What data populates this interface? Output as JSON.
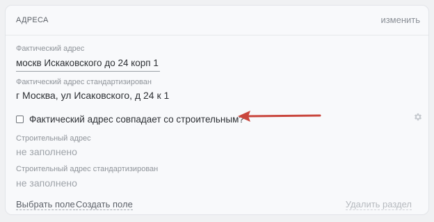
{
  "section": {
    "title": "АДРЕСА",
    "edit_label": "изменить"
  },
  "fields": {
    "actual_address": {
      "label": "Фактический адрес",
      "value": "москв Искаковского до 24 корп 1"
    },
    "actual_address_std": {
      "label": "Фактический адрес стандартизирован",
      "value": "г Москва, ул Исаковского, д 24 к 1"
    },
    "same_as_construction": {
      "label": "Фактический адрес совпадает со строительным?",
      "checked": false
    },
    "construction_address": {
      "label": "Строительный адрес",
      "value": "не заполнено"
    },
    "construction_address_std": {
      "label": "Строительный адрес стандартизирован",
      "value": "не заполнено"
    }
  },
  "footer": {
    "choose_field": "Выбрать поле",
    "create_field": "Создать поле",
    "delete_section": "Удалить раздел"
  },
  "icons": {
    "settings": "gear-icon",
    "annotation": "arrow-left-icon"
  },
  "colors": {
    "arrow": "#c9463d",
    "card_background": "#f8f9fb",
    "muted_text": "#9ea3a9"
  }
}
